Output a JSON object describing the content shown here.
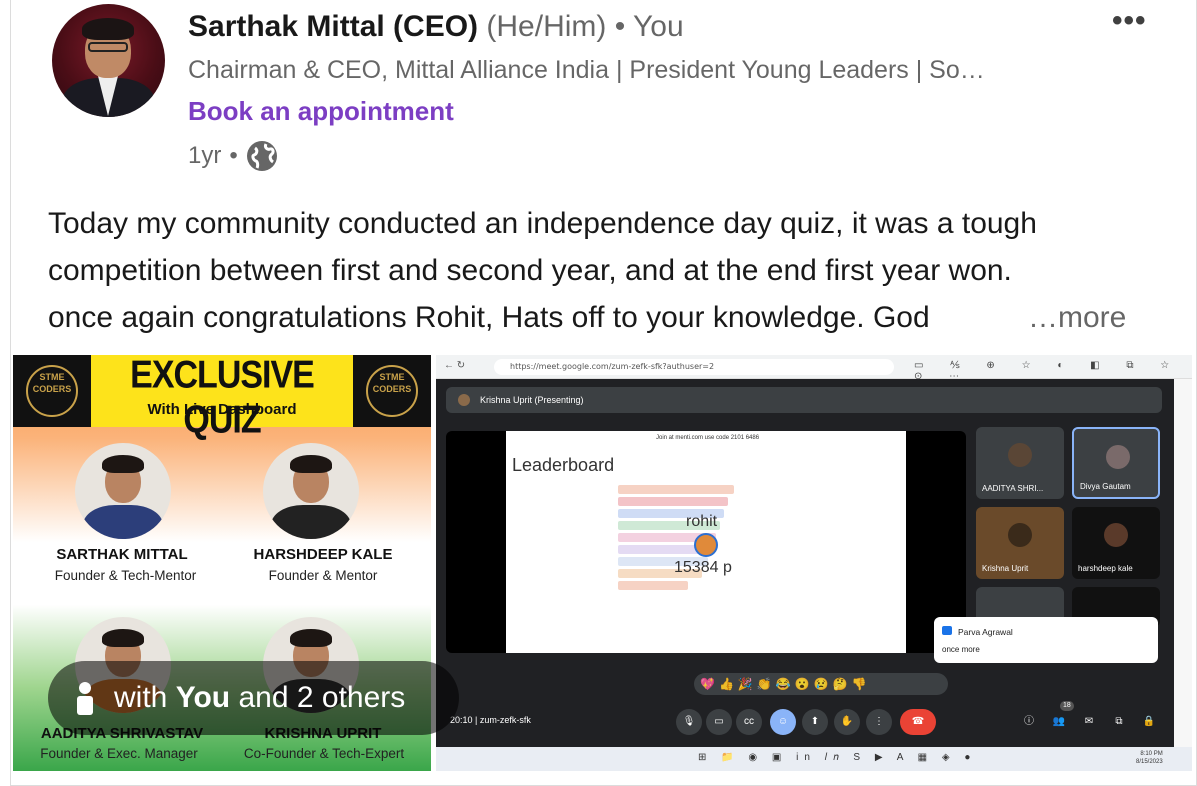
{
  "post": {
    "author_name": "Sarthak Mittal (CEO)",
    "pronouns": "(He/Him)",
    "connection": "• You",
    "headline": "Chairman & CEO, Mittal Alliance India | President Young Leaders | So…",
    "cta": "Book an appointment",
    "age": "1yr",
    "separator": "•",
    "visibility_icon": "globe-icon",
    "menu_icon": "•••",
    "text_line1": "Today my community conducted an independence day quiz, it was a tough",
    "text_line2": "competition between first and second year, and at the end first year won.",
    "text_line3": "once again congratulations Rohit, Hats off to your knowledge. God",
    "more_label": "…more",
    "tag_pre": "with",
    "tag_bold": "You",
    "tag_post": "and 2 others"
  },
  "poster": {
    "title": "EXCLUSIVE QUIZ",
    "subtitle": "With Live Dashboard",
    "logo_text": "STME CODERS",
    "people": [
      {
        "name": "SARTHAK MITTAL",
        "role": "Founder & Tech-Mentor"
      },
      {
        "name": "HARSHDEEP KALE",
        "role": "Founder & Mentor"
      },
      {
        "name": "AADITYA SHRIVASTAV",
        "role": "Founder & Exec. Manager"
      },
      {
        "name": "KRISHNA UPRIT",
        "role": "Co-Founder & Tech-Expert"
      }
    ],
    "colors": {
      "saffron": "#f79443",
      "green": "#3aa64a",
      "banner": "#fde31b"
    }
  },
  "meet": {
    "url": "https://meet.google.com/zum-zefk-sfk?authuser=2",
    "presenting": "Krishna Uprit (Presenting)",
    "slide_join": "Join at menti.com use code 2101 6486",
    "slide_title": "Leaderboard",
    "highlight_name": "rohit",
    "highlight_score": "15384 p",
    "participants": [
      "AADITYA SHRI...",
      "Divya Gautam",
      "Krishna Uprit",
      "harshdeep kale"
    ],
    "chat_sender": "Parva Agrawal",
    "chat_message": "once more",
    "time": "20:10",
    "meeting_code": "zum-zefk-sfk",
    "participant_count": "18",
    "clock_time": "8:10 PM",
    "clock_date": "8/15/2023"
  }
}
